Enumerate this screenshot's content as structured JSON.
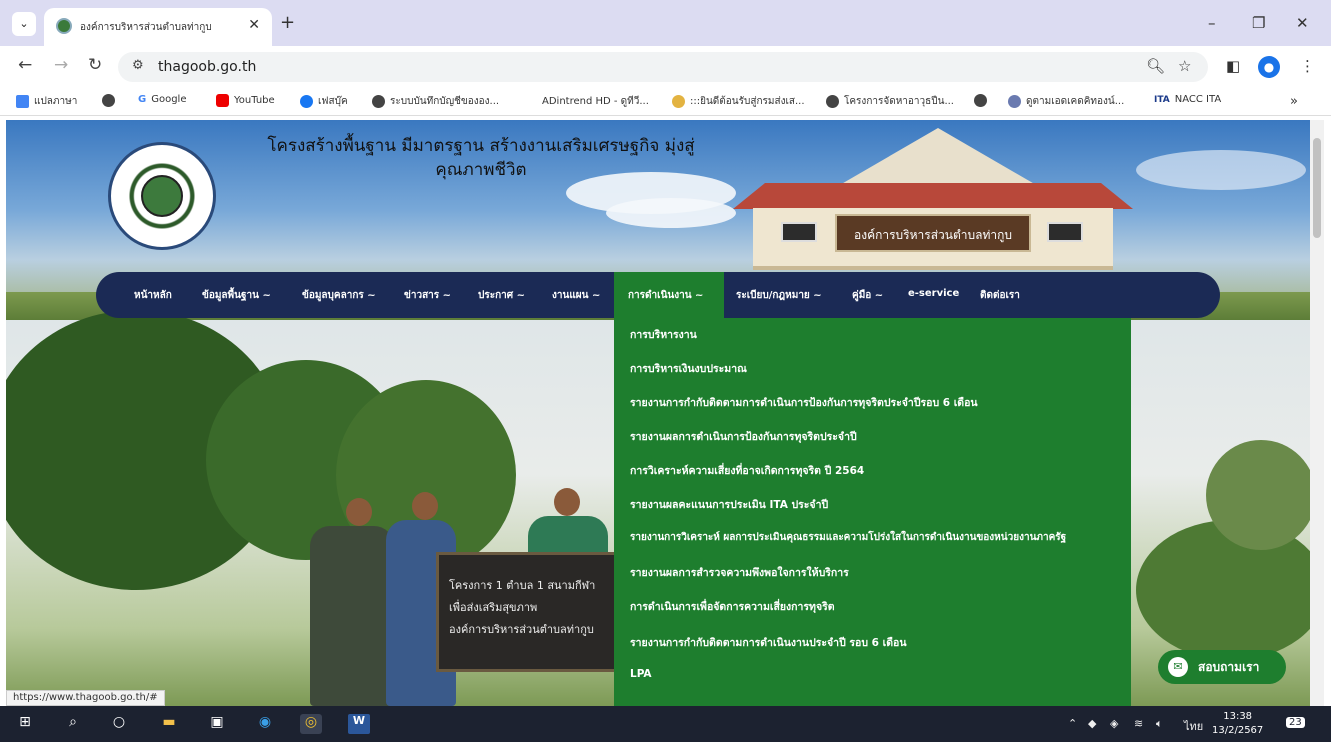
{
  "browser": {
    "tab_title": "องค์การบริหารส่วนตำบลท่ากูบ",
    "url": "thagoob.go.th",
    "bookmarks": [
      "แปลภาษา",
      "Google",
      "YouTube",
      "เฟสบุ๊ค",
      "ระบบบันทึกบัญชีขององ...",
      "ADintrend HD - ดูทีวี...",
      ":::ยินดีต้อนรับสู่กรมส่งเส...",
      "โครงการจัดหาอาวุธปืน...",
      "ดูตามเอดเคดคิทองน์...",
      "NACC ITA"
    ],
    "status_url": "https://www.thagoob.go.th/#"
  },
  "site": {
    "slogan_line1": "โครงสร้างพื้นฐาน มีมาตรฐาน สร้างงานเสริมเศรษฐกิจ มุ่งสู่",
    "slogan_line2": "คุณภาพชีวิต",
    "building_sign": "องค์การบริหารส่วนตำบลท่ากูบ",
    "board_line1": "โครงการ 1 ตำบล 1 สนามกีฬา",
    "board_line2": "เพื่อส่งเสริมสุขภาพ",
    "board_line3": "องค์การบริหารส่วนตำบลท่ากูบ"
  },
  "nav": {
    "items": [
      "หน้าหลัก",
      "ข้อมูลพื้นฐาน ~",
      "ข้อมูลบุคลากร ~",
      "ข่าวสาร ~",
      "ประกาศ ~",
      "งานแผน ~",
      "การดำเนินงาน ~",
      "ระเบียบ/กฎหมาย ~",
      "คู่มือ ~",
      "e-service",
      "ติดต่อเรา"
    ],
    "active_index": 6
  },
  "dropdown": {
    "items": [
      "การบริหารงาน",
      "การบริหารเงินงบประมาณ",
      "รายงานการกำกับติดตามการดำเนินการป้องกันการทุจริตประจำปีรอบ 6 เดือน",
      "รายงานผลการดำเนินการป้องกันการทุจริตประจำปี",
      "การวิเคราะห์ความเสี่ยงที่อาจเกิดการทุจริต ปี 2564",
      "รายงานผลคะแนนการประเมิน ITA ประจำปี",
      "รายงานการวิเคราะห์ ผลการประเมินคุณธรรมและความโปร่งใสในการดำเนินงานของหน่วยงานภาครัฐ",
      "รายงานผลการสำรวจความพึงพอใจการให้บริการ",
      "การดำเนินการเพื่อจัดการความเสี่ยงการทุจริต",
      "รายงานการกำกับติดตามการดำเนินงานประจำปี รอบ 6 เดือน",
      "LPA"
    ]
  },
  "chat": {
    "label": "สอบถามเรา"
  },
  "taskbar": {
    "language": "ไทย",
    "time": "13:38",
    "date": "13/2/2567",
    "notifications": "23"
  },
  "colors": {
    "nav_bg": "#1b2a55",
    "active_green": "#1e7e2e",
    "tabbar_bg": "#dcdcf2",
    "taskbar_bg": "#1c2230"
  }
}
